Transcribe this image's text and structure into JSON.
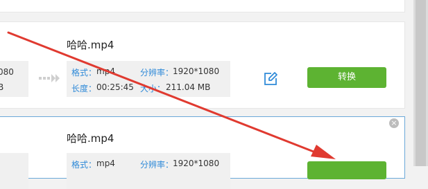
{
  "items": [
    {
      "title": "哈哈.mp4",
      "source_info": {
        "line1": "080",
        "line2": "B"
      },
      "format_label": "格式：",
      "format_value": "mp4",
      "resolution_label": "分辨率：",
      "resolution_value": "1920*1080",
      "duration_label": "长度：",
      "duration_value": "00:25:45",
      "size_label": "大小：",
      "size_value": "211.04 MB",
      "convert_label": "转换"
    },
    {
      "title": "哈哈.mp4",
      "format_label": "格式：",
      "format_value": "mp4",
      "resolution_label": "分辨率：",
      "resolution_value": "1920*1080"
    }
  ],
  "close_icon": "×",
  "colors": {
    "accent_green": "#5db332",
    "label_blue": "#2f8ad8",
    "annotation_red": "#e03a30"
  },
  "icons": [
    "edit-icon",
    "double-chevron-right-icon",
    "close-icon"
  ]
}
